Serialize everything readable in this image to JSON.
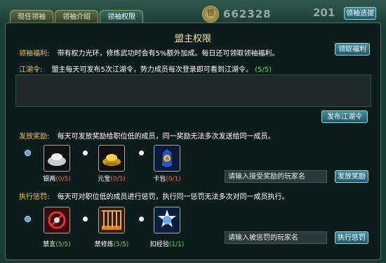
{
  "tabs": [
    {
      "label": "现任领袖",
      "active": false
    },
    {
      "label": "领袖介绍",
      "active": false
    },
    {
      "label": "领袖权限",
      "active": true
    }
  ],
  "currency": {
    "coin_glyph": "银",
    "amount": "662328",
    "second_amount": "201"
  },
  "header_button": "领袖选拔",
  "panel_title": "盟主权限",
  "welfare": {
    "label": "领袖福利:",
    "text": "带有权力光环，修炼武功时会有5%额外加成。每日还可领取领袖福利。",
    "button": "领取福利"
  },
  "jianghu": {
    "label": "江湖令:",
    "text": "盟主每天可发布5次江湖令，势力成员每次登录即可看到江湖令。",
    "count": "(5/5)",
    "textarea_value": "",
    "button": "发布江湖令"
  },
  "reward": {
    "label": "发放奖励:",
    "text": "每天可发放奖励给职位低的成员，同一奖励无法多次发送给同一成员。",
    "items": [
      {
        "name": "银两",
        "count": "(0/5)",
        "icon": "silver-ingot-icon",
        "selected": true
      },
      {
        "name": "元宝",
        "count": "(0/5)",
        "icon": "gold-ingot-icon",
        "selected": false
      },
      {
        "name": "卡包",
        "count": "(0/1)",
        "icon": "card-pack-icon",
        "selected": false
      }
    ],
    "input_placeholder": "请输入接受奖励的玩家名",
    "button": "发放奖励"
  },
  "punish": {
    "label": "执行惩罚:",
    "text": "每天可对职位低的成员进行惩罚，执行同一惩罚无法多次对同一成员执行。",
    "items": [
      {
        "name": "禁言",
        "count": "(5/5)",
        "icon": "mute-icon",
        "selected": true
      },
      {
        "name": "禁修炼",
        "count": "(5/5)",
        "icon": "cage-icon",
        "selected": false
      },
      {
        "name": "扣经验",
        "count": "(1/1)",
        "icon": "deduct-exp-icon",
        "selected": false
      }
    ],
    "input_placeholder": "请输入被惩罚的玩家名",
    "button": "执行惩罚"
  },
  "colors": {
    "label_yellow": "#f3c654",
    "count_green": "#5bd45b",
    "count_red": "#ff6060",
    "button_teal": "#2e7484"
  }
}
